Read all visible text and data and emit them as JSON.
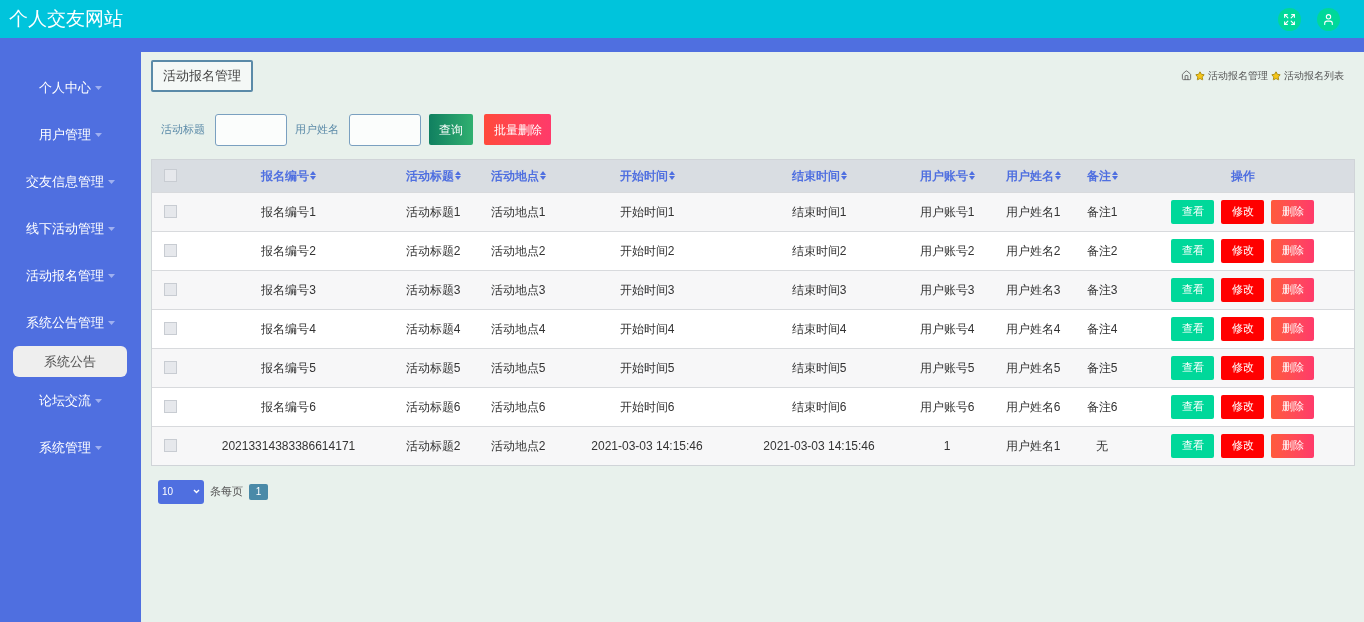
{
  "header": {
    "title": "个人交友网站"
  },
  "sidebar": {
    "items": [
      {
        "label": "个人中心"
      },
      {
        "label": "用户管理"
      },
      {
        "label": "交友信息管理"
      },
      {
        "label": "线下活动管理"
      },
      {
        "label": "活动报名管理"
      },
      {
        "label": "系统公告管理",
        "children": [
          {
            "label": "系统公告",
            "hovered": true
          }
        ]
      },
      {
        "label": "论坛交流"
      },
      {
        "label": "系统管理"
      }
    ]
  },
  "page_title": "活动报名管理",
  "breadcrumb": [
    "活动报名管理",
    "活动报名列表"
  ],
  "search": {
    "fields": [
      {
        "label": "活动标题"
      },
      {
        "label": "用户姓名"
      }
    ],
    "query_button": "查询",
    "batch_delete_button": "批量删除"
  },
  "table": {
    "header_checked": false,
    "columns": [
      "报名编号",
      "活动标题",
      "活动地点",
      "开始时间",
      "结束时间",
      "用户账号",
      "用户姓名",
      "备注",
      "操作"
    ],
    "rows": [
      {
        "checked": false,
        "cells": [
          "报名编号1",
          "活动标题1",
          "活动地点1",
          "开始时间1",
          "结束时间1",
          "用户账号1",
          "用户姓名1",
          "备注1"
        ],
        "actions": [
          "查看",
          "修改",
          "删除"
        ]
      },
      {
        "checked": false,
        "cells": [
          "报名编号2",
          "活动标题2",
          "活动地点2",
          "开始时间2",
          "结束时间2",
          "用户账号2",
          "用户姓名2",
          "备注2"
        ],
        "actions": [
          "查看",
          "修改",
          "删除"
        ]
      },
      {
        "checked": false,
        "cells": [
          "报名编号3",
          "活动标题3",
          "活动地点3",
          "开始时间3",
          "结束时间3",
          "用户账号3",
          "用户姓名3",
          "备注3"
        ],
        "actions": [
          "查看",
          "修改",
          "删除"
        ]
      },
      {
        "checked": false,
        "cells": [
          "报名编号4",
          "活动标题4",
          "活动地点4",
          "开始时间4",
          "结束时间4",
          "用户账号4",
          "用户姓名4",
          "备注4"
        ],
        "actions": [
          "查看",
          "修改",
          "删除"
        ]
      },
      {
        "checked": false,
        "cells": [
          "报名编号5",
          "活动标题5",
          "活动地点5",
          "开始时间5",
          "结束时间5",
          "用户账号5",
          "用户姓名5",
          "备注5"
        ],
        "actions": [
          "查看",
          "修改",
          "删除"
        ]
      },
      {
        "checked": false,
        "cells": [
          "报名编号6",
          "活动标题6",
          "活动地点6",
          "开始时间6",
          "结束时间6",
          "用户账号6",
          "用户姓名6",
          "备注6"
        ],
        "actions": [
          "查看",
          "修改",
          "删除"
        ]
      },
      {
        "checked": false,
        "cells": [
          "20213314383386614171",
          "活动标题2",
          "活动地点2",
          "2021-03-03 14:15:46",
          "2021-03-03 14:15:46",
          "1",
          "用户姓名1",
          "无"
        ],
        "actions": [
          "查看",
          "修改",
          "删除"
        ]
      }
    ]
  },
  "pagination": {
    "page_size": "10",
    "page_size_label": "条每页",
    "pages": [
      {
        "label": "1",
        "selected": true
      }
    ]
  }
}
